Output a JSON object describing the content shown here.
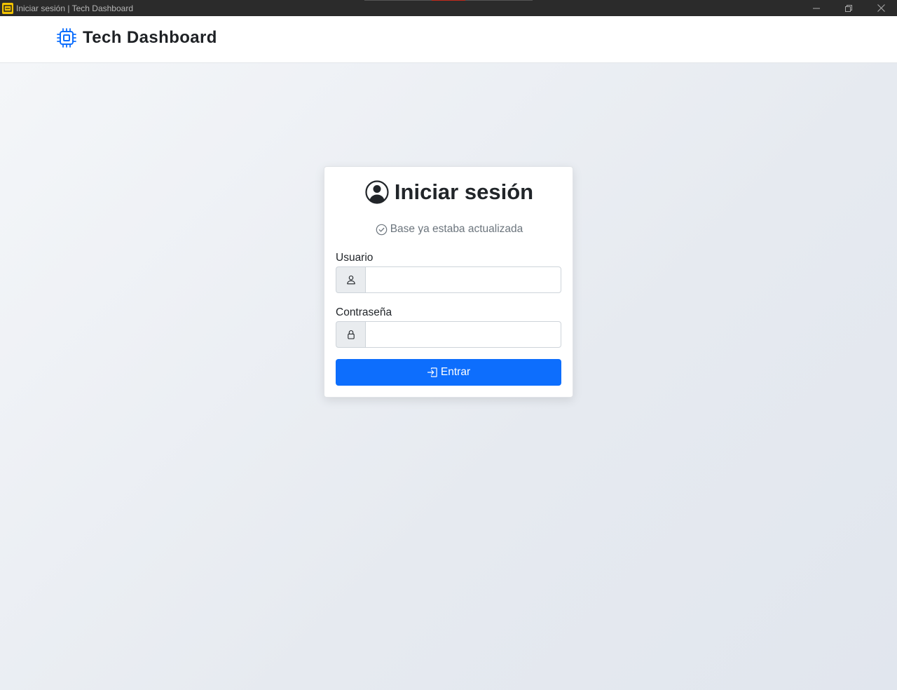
{
  "window": {
    "title": "Iniciar sesión | Tech Dashboard",
    "app_icon": "app-icon",
    "controls": [
      "minimize-icon",
      "restore-icon",
      "close-icon"
    ]
  },
  "header": {
    "brand_icon": "cpu-icon",
    "brand": "Tech Dashboard"
  },
  "login": {
    "title_icon": "user-circle-icon",
    "title": "Iniciar sesión",
    "status_icon": "check-circle-icon",
    "status": "Base ya estaba actualizada",
    "username_label": "Usuario",
    "username_icon": "person-icon",
    "username_value": "",
    "password_label": "Contraseña",
    "password_icon": "lock-icon",
    "password_value": "",
    "submit_icon": "box-arrow-in-right-icon",
    "submit_label": "Entrar"
  },
  "colors": {
    "primary": "#0d6efd",
    "brand_icon": "#0d6efd",
    "titlebar": "#2b2b2b",
    "text": "#212529",
    "muted": "#6c757d"
  }
}
